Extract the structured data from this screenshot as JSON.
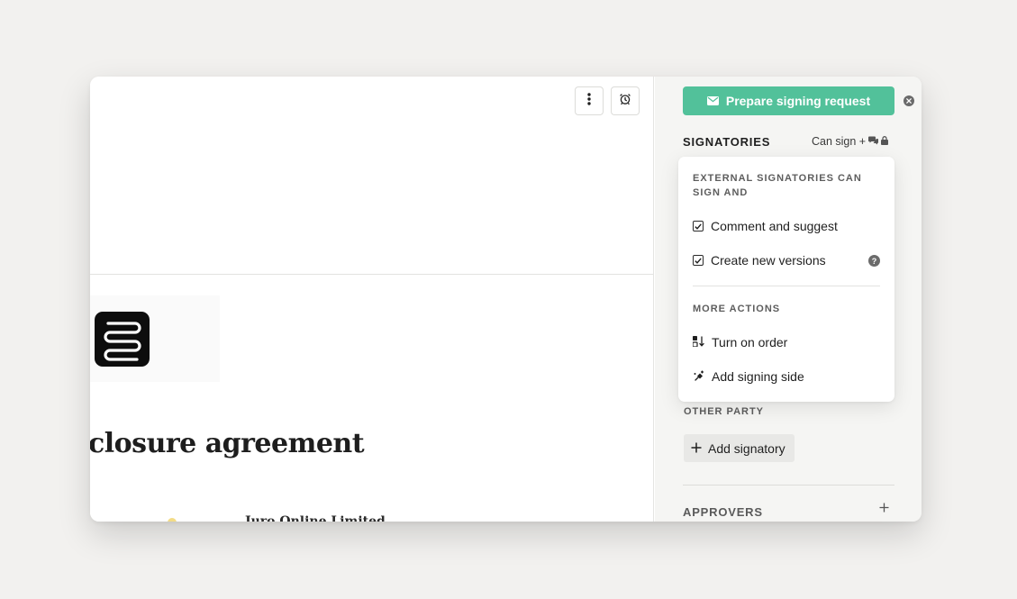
{
  "document": {
    "title": "closure agreement",
    "party_name": "Juro Online Limited",
    "toolbar": {
      "more_icon": "more-vertical-icon",
      "alarm_icon": "alarm-clock-icon"
    },
    "logo_icon": "juro-logo-icon"
  },
  "sidebar": {
    "primary_button": {
      "label": "Prepare signing request",
      "icon": "envelope-icon",
      "color": "#52c19a"
    },
    "close_icon": "close-icon",
    "signatories": {
      "heading": "SIGNATORIES",
      "permission_label": "Can sign +",
      "permission_icons": [
        "comment-icon",
        "lock-icon"
      ]
    },
    "other_party": {
      "heading": "OTHER PARTY",
      "add_label": "Add signatory"
    },
    "approvers": {
      "heading": "APPROVERS",
      "add_icon": "plus-icon"
    }
  },
  "popover": {
    "external_heading": "EXTERNAL SIGNATORIES CAN SIGN AND",
    "options": [
      {
        "label": "Comment and suggest",
        "checked": true
      },
      {
        "label": "Create new versions",
        "checked": true,
        "help_icon": "help-icon"
      }
    ],
    "more_heading": "MORE ACTIONS",
    "actions": [
      {
        "label": "Turn on order",
        "icon": "sort-order-icon"
      },
      {
        "label": "Add signing side",
        "icon": "add-side-icon"
      }
    ]
  }
}
